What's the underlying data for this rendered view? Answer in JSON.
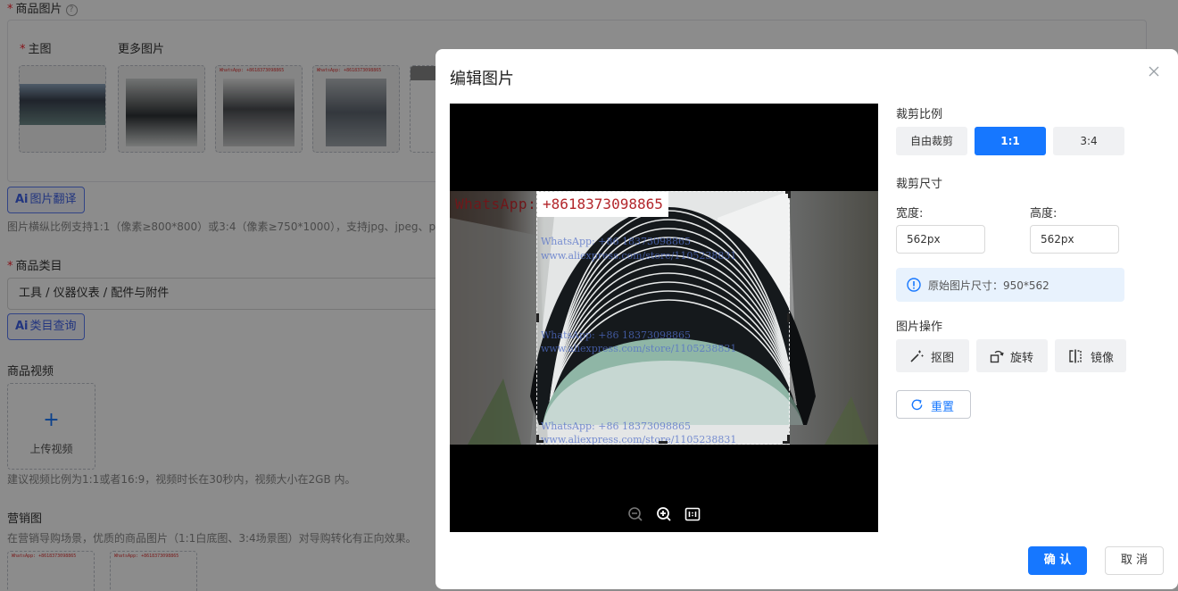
{
  "form": {
    "product_images_label": "商品图片",
    "main_image_label": "主图",
    "more_images_label": "更多图片",
    "ai_translate_label": "图片翻译",
    "ai_prefix": "Ai",
    "image_note": "图片横纵比例支持1:1（像素≥800*800）或3:4（像素≥750*1000），支持jpg、jpeg、png格",
    "thumb_watermark": "WhatsApp: +8618373098865",
    "category_label": "商品类目",
    "category_value": "工具 / 仪器仪表 / 配件与附件",
    "category_query_label": "类目查询",
    "video_label": "商品视频",
    "upload_video_label": "上传视频",
    "upload_plus": "+",
    "video_note": "建议视频比例为1:1或者16:9，视频时长在30秒内，视频大小在2GB 内。",
    "marketing_label": "营销图",
    "marketing_note": "在营销导购场景，优质的商品图片（1:1白底图、3:4场景图）对导购转化有正向效果。"
  },
  "modal": {
    "title": "编辑图片",
    "image": {
      "whatsapp_prefix": "WhatsApp:",
      "whatsapp_number": "+8618373098865",
      "watermark_lines": [
        "WhatsApp: +86 18373098865",
        "www.aliexpress.com/store/1105238831"
      ]
    },
    "crop_ratio": {
      "label": "裁剪比例",
      "options": [
        "自由裁剪",
        "1:1",
        "3:4"
      ],
      "selected": "1:1"
    },
    "crop_size": {
      "label": "裁剪尺寸",
      "width_label": "宽度:",
      "width_value": "562px",
      "height_label": "高度:",
      "height_value": "562px"
    },
    "original_size": "原始图片尺寸：950*562",
    "operations": {
      "label": "图片操作",
      "cutout": "抠图",
      "rotate": "旋转",
      "mirror": "镜像",
      "reset": "重置"
    },
    "confirm": "确 认",
    "cancel": "取 消"
  },
  "colors": {
    "primary": "#1677ff",
    "required": "#f5222d",
    "watermark_red": "#b3262b"
  }
}
